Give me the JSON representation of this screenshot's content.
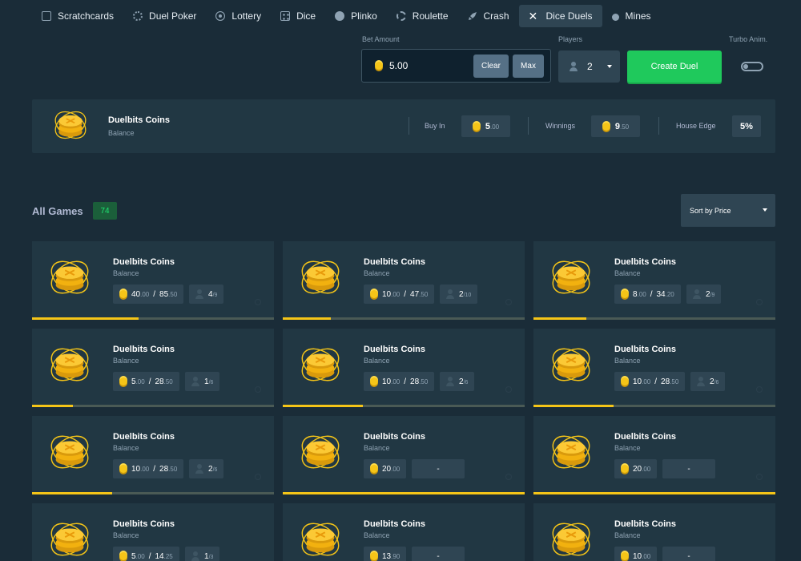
{
  "nav": [
    {
      "label": "Scratchcards",
      "icon": "card-icon",
      "active": false
    },
    {
      "label": "Duel Poker",
      "icon": "poker-chip-icon",
      "active": false
    },
    {
      "label": "Lottery",
      "icon": "lottery-ball-icon",
      "active": false
    },
    {
      "label": "Dice",
      "icon": "dice-icon",
      "active": false
    },
    {
      "label": "Plinko",
      "icon": "plinko-icon",
      "active": false
    },
    {
      "label": "Roulette",
      "icon": "roulette-icon",
      "active": false
    },
    {
      "label": "Crash",
      "icon": "rocket-icon",
      "active": false
    },
    {
      "label": "Dice Duels",
      "icon": "swords-icon",
      "active": true
    },
    {
      "label": "Mines",
      "icon": "bomb-icon",
      "active": false
    }
  ],
  "bet": {
    "label": "Bet Amount",
    "value": "5.00",
    "clear_label": "Clear",
    "max_label": "Max"
  },
  "players": {
    "label": "Players",
    "value": "2"
  },
  "create_label": "Create Duel",
  "turbo_label": "Turbo Anim.",
  "summary": {
    "title": "Duelbits Coins",
    "subtitle": "Balance",
    "buyin_label": "Buy In",
    "buyin_int": "5",
    "buyin_dec": ".00",
    "winnings_label": "Winnings",
    "winnings_int": "9",
    "winnings_dec": ".50",
    "house_edge_label": "House Edge",
    "house_edge": "5%"
  },
  "all_games": {
    "title": "All Games",
    "count": "74",
    "sort_label": "Sort by Price"
  },
  "colors": {
    "accent_green": "#1fc95c",
    "coin_gold": "#f5c518",
    "bg": "#1a2c38",
    "panel": "#213743"
  },
  "cards": [
    {
      "title": "Duelbits Coins",
      "sub": "Balance",
      "buy_int": "40",
      "buy_dec": ".00",
      "total_int": "85",
      "total_dec": ".50",
      "players": "4",
      "max": "9",
      "progress": 0.44
    },
    {
      "title": "Duelbits Coins",
      "sub": "Balance",
      "buy_int": "10",
      "buy_dec": ".00",
      "total_int": "47",
      "total_dec": ".50",
      "players": "2",
      "max": "10",
      "progress": 0.2
    },
    {
      "title": "Duelbits Coins",
      "sub": "Balance",
      "buy_int": "8",
      "buy_dec": ".00",
      "total_int": "34",
      "total_dec": ".20",
      "players": "2",
      "max": "9",
      "progress": 0.22
    },
    {
      "title": "Duelbits Coins",
      "sub": "Balance",
      "buy_int": "5",
      "buy_dec": ".00",
      "total_int": "28",
      "total_dec": ".50",
      "players": "1",
      "max": "6",
      "progress": 0.17
    },
    {
      "title": "Duelbits Coins",
      "sub": "Balance",
      "buy_int": "10",
      "buy_dec": ".00",
      "total_int": "28",
      "total_dec": ".50",
      "players": "2",
      "max": "6",
      "progress": 0.33
    },
    {
      "title": "Duelbits Coins",
      "sub": "Balance",
      "buy_int": "10",
      "buy_dec": ".00",
      "total_int": "28",
      "total_dec": ".50",
      "players": "2",
      "max": "6",
      "progress": 0.33
    },
    {
      "title": "Duelbits Coins",
      "sub": "Balance",
      "buy_int": "10",
      "buy_dec": ".00",
      "total_int": "28",
      "total_dec": ".50",
      "players": "2",
      "max": "6",
      "progress": 0.33
    },
    {
      "title": "Duelbits Coins",
      "sub": "Balance",
      "buy_int": "20",
      "buy_dec": ".00",
      "total_int": "",
      "total_dec": "",
      "players": "",
      "max": "",
      "dash": "-",
      "progress": 1.0
    },
    {
      "title": "Duelbits Coins",
      "sub": "Balance",
      "buy_int": "20",
      "buy_dec": ".00",
      "total_int": "",
      "total_dec": "",
      "players": "",
      "max": "",
      "dash": "-",
      "progress": 1.0
    },
    {
      "title": "Duelbits Coins",
      "sub": "Balance",
      "buy_int": "5",
      "buy_dec": ".00",
      "total_int": "14",
      "total_dec": ".25",
      "players": "1",
      "max": "3",
      "progress": 0.33
    },
    {
      "title": "Duelbits Coins",
      "sub": "Balance",
      "buy_int": "13",
      "buy_dec": ".90",
      "total_int": "",
      "total_dec": "",
      "players": "",
      "max": "",
      "dash": "-",
      "progress": 1.0
    },
    {
      "title": "Duelbits Coins",
      "sub": "Balance",
      "buy_int": "10",
      "buy_dec": ".00",
      "total_int": "",
      "total_dec": "",
      "players": "",
      "max": "",
      "dash": "-",
      "progress": 1.0
    }
  ]
}
